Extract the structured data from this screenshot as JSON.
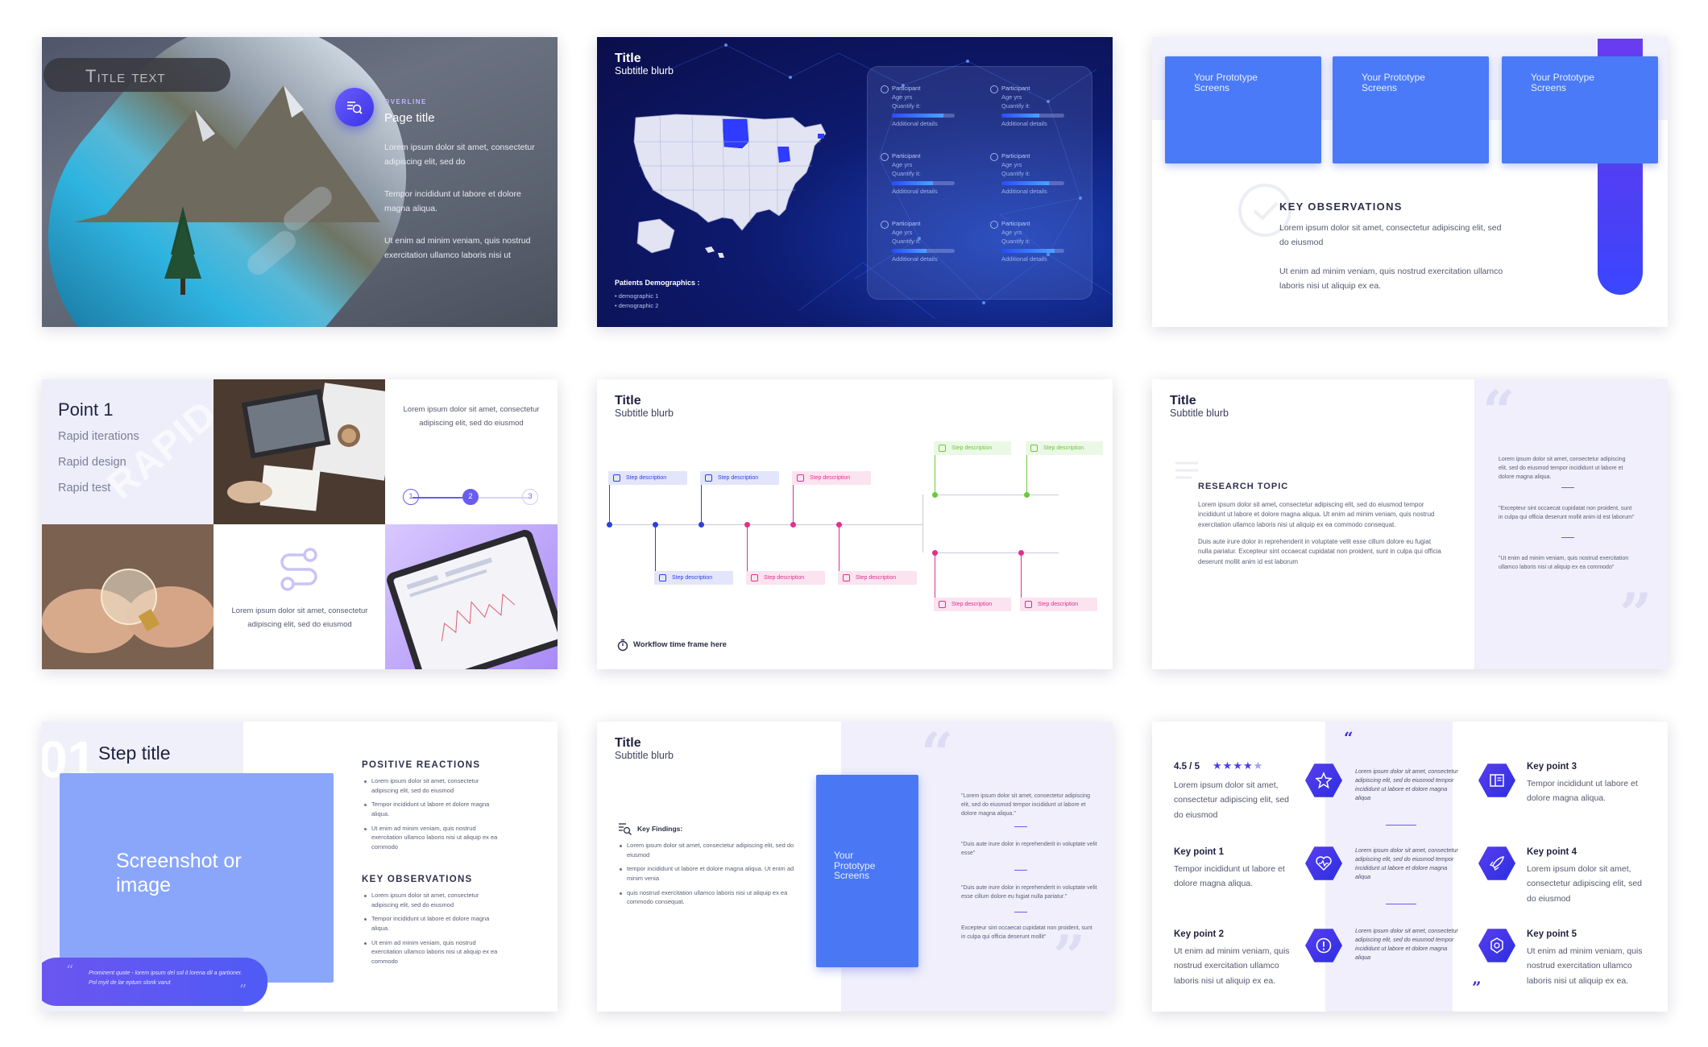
{
  "slide1": {
    "title_text": "Title text",
    "overline": "OVERLINE",
    "page_title": "Page title",
    "para1": "Lorem ipsum dolor sit amet, consectetur adipiscing elit, sed do",
    "para2": "Tempor incididunt ut labore et dolore magna aliqua.",
    "para3": "Ut enim ad minim veniam, quis nostrud exercitation ullamco laboris nisi ut"
  },
  "slide2": {
    "title": "Title",
    "subtitle": "Subtitle blurb",
    "participants": [
      {
        "name": "Participant",
        "age": "Age yrs",
        "qty": "Quantify it:",
        "details": "Additional details",
        "fill": 0.82
      },
      {
        "name": "Participant",
        "age": "Age yrs",
        "qty": "Quantify it:",
        "details": "Additional details",
        "fill": 0.6
      },
      {
        "name": "Participant",
        "age": "Age yrs",
        "qty": "Quantify it:",
        "details": "Additional details",
        "fill": 0.65
      },
      {
        "name": "Participant",
        "age": "Age yrs",
        "qty": "Quantify it:",
        "details": "Additional details",
        "fill": 0.75
      },
      {
        "name": "Participant",
        "age": "Age yrs",
        "qty": "Quantify it:",
        "details": "Additional details",
        "fill": 0.55
      },
      {
        "name": "Participant",
        "age": "Age yrs",
        "qty": "Quantify it:",
        "details": "Additional details",
        "fill": 0.85
      }
    ],
    "demographics_label": "Patients Demographics :",
    "demographics": [
      "demographic 1",
      "demographic 2"
    ]
  },
  "slide3": {
    "screens": [
      "Your Prototype Screens",
      "Your Prototype Screens",
      "Your Prototype Screens"
    ],
    "ko_title": "KEY OBSERVATIONS",
    "ko_para1": "Lorem ipsum dolor sit amet, consectetur adipiscing elit, sed do eiusmod",
    "ko_para2": "Ut enim ad minim veniam, quis nostrud exercitation ullamco laboris nisi ut aliquip ex ea."
  },
  "slide4": {
    "point_title": "Point 1",
    "items": [
      "Rapid iterations",
      "Rapid design",
      "Rapid test"
    ],
    "watermark": "RAPID",
    "text_top": "Lorem ipsum dolor sit amet, consectetur adipiscing elit, sed do eiusmod",
    "text_bottom": "Lorem ipsum dolor sit amet, consectetur adipiscing elit, sed do eiusmod",
    "steps": [
      "1",
      "2",
      "3"
    ],
    "active_step": "2"
  },
  "slide5": {
    "title": "Title",
    "subtitle": "Subtitle blurb",
    "step_label": "Step description",
    "footer": "Workflow time frame here",
    "colors": {
      "blue": "#2d3fe0",
      "pink": "#e0308f",
      "green": "#6cc93a"
    }
  },
  "slide6": {
    "title": "Title",
    "subtitle": "Subtitle blurb",
    "topic": "RESEARCH TOPIC",
    "para1": "Lorem ipsum dolor sit amet, consectetur adipiscing elit, sed do eiusmod tempor incididunt ut labore et dolore magna aliqua. Ut enim ad minim veniam, quis nostrud exercitation ullamco laboris nisi ut aliquip ex ea commodo consequat.",
    "para2": "Duis aute irure dolor in reprehenderit in voluptate velit esse cillum dolore eu fugiat nulla pariatur. Excepteur sint occaecat cupidatat non proident, sunt in culpa qui officia deserunt mollit anim id est laborum",
    "quotes": [
      "Lorem ipsum dolor sit amet, consectetur adipiscing elit, sed do eiusmod tempor incididunt ut labore et dolore magna aliqua.",
      "\"Excepteur sint occaecat cupidatat non proident, sunt in culpa qui officia deserunt mollit anim id est laborum\"",
      "\"Ut enim ad minim veniam, quis nostrud exercitation ullamco laboris nisi ut aliquip ex ea commodo\""
    ]
  },
  "slide7": {
    "step_num": "01",
    "step_title": "Step title",
    "image_label": "Screenshot or image",
    "quote": "Prominent quote - lorem ipsum del sol it lorena dil a gartioner. Pol myit de lar eptum slonk varut",
    "pos_title": "POSITIVE REACTIONS",
    "pos_items": [
      "Lorem ipsum dolor sit amet, consectetur adipiscing elit, sed do eiusmod",
      "Tempor incididunt ut labore et dolore magna aliqua.",
      "Ut enim ad minim veniam, quis nostrud exercitation ullamco laboris nisi ut aliquip ex ea commodo"
    ],
    "ko_title": "KEY OBSERVATIONS",
    "ko_items": [
      "Lorem ipsum dolor sit amet, consectetur adipiscing elit, sed do eiusmod",
      "Tempor incididunt ut labore et dolore magna aliqua.",
      "Ut enim ad minim veniam, quis nostrud exercitation ullamco laboris nisi ut aliquip ex ea commodo"
    ]
  },
  "slide8": {
    "title": "Title",
    "subtitle": "Subtitle blurb",
    "findings_label": "Key Findings:",
    "findings": [
      "Lorem ipsum dolor sit amet, consectetur adipiscing elit, sed do eiusmod",
      "tempor incididunt ut labore et dolore magna aliqua. Ut enim ad minim venia",
      "quis nostrud exercitation ullamco laboris nisi ut aliquip ex ea commodo consequat."
    ],
    "screen_label": "Your Prototype Screens",
    "quotes": [
      "\"Lorem ipsum dolor sit amet, consectetur adipiscing elit, sed do eiusmod tempor incididunt ut labore et dolore magna aliqua.\"",
      "\"Duis aute irure dolor in reprehenderit in voluptate velit esse\"",
      "\"Duis aute irure dolor in reprehenderit in voluptate velit esse cillum dolore eu fugiat nulla pariatur.\"",
      "Excepteur sint occaecat cupidatat non proident, sunt in culpa qui officia deserunt mollit\""
    ]
  },
  "slide9": {
    "rating": "4.5 / 5",
    "rating_value": 4.5,
    "rating_text": "Lorem ipsum dolor sit amet, consectetur adipiscing elit, sed do eiusmod",
    "kp1_title": "Key point 1",
    "kp1_text": "Tempor incididunt ut labore et dolore magna aliqua.",
    "kp2_title": "Key point 2",
    "kp2_text": "Ut enim ad minim veniam, quis nostrud exercitation ullamco laboris nisi ut aliquip ex ea.",
    "kp3_title": "Key point 3",
    "kp3_text": "Tempor incididunt ut labore et dolore magna aliqua.",
    "kp4_title": "Key point 4",
    "kp4_text": "Lorem ipsum dolor sit amet, consectetur adipiscing elit, sed do eiusmod",
    "kp5_title": "Key point 5",
    "kp5_text": "Ut enim ad minim veniam, quis nostrud exercitation ullamco laboris nisi ut aliquip ex ea.",
    "mid_text": "Lorem ipsum dolor sit amet, consectetur adipiscing elit, sed do eiusmod tempor incididunt ut labore et dolore magna aliqua",
    "icons": [
      "star-icon",
      "heartbeat-icon",
      "alert-icon",
      "book-icon",
      "rocket-icon",
      "badge-icon"
    ]
  }
}
